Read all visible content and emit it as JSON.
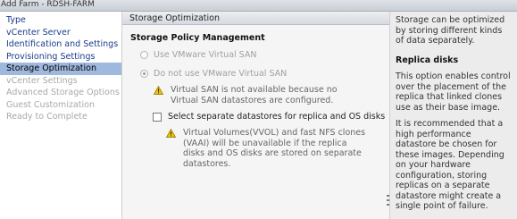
{
  "window": {
    "title": "Add Farm - RDSH-FARM"
  },
  "sidebar": {
    "items": [
      {
        "label": "Type",
        "state": "link"
      },
      {
        "label": "vCenter Server",
        "state": "link"
      },
      {
        "label": "Identification and Settings",
        "state": "link"
      },
      {
        "label": "Provisioning Settings",
        "state": "link"
      },
      {
        "label": "Storage Optimization",
        "state": "active"
      },
      {
        "label": "vCenter Settings",
        "state": "disabled"
      },
      {
        "label": "Advanced Storage Options",
        "state": "disabled"
      },
      {
        "label": "Guest Customization",
        "state": "disabled"
      },
      {
        "label": "Ready to Complete",
        "state": "disabled"
      }
    ]
  },
  "main": {
    "header": "Storage Optimization",
    "section_title": "Storage Policy Management",
    "radio_use_vsan": "Use VMware Virtual SAN",
    "radio_no_vsan": "Do not use VMware Virtual SAN",
    "vsan_warning": "Virtual SAN is not available because no\nVirtual SAN datastores are configured.",
    "separate_datastores_label": "Select separate datastores for replica and OS disks",
    "vvol_warning": "Virtual Volumes(VVOL) and fast NFS clones\n(VAAI) will be unavailable if the replica\ndisks and OS disks are stored on separate\ndatastores."
  },
  "help": {
    "intro": "Storage can be optimized by storing different kinds of data separately.",
    "title": "Replica disks",
    "paragraph1": "This option enables control over the placement of the replica that linked clones use as their base image.",
    "paragraph2": "It is recommended that a high performance datastore be chosen for these images. Depending on your hardware configuration, storing replicas on a separate datastore might create a single point of failure."
  },
  "colors": {
    "active_nav": "#9eb8de",
    "link": "#1a3c8c",
    "disabled": "#a8a8a8",
    "warning": "#f2c200"
  },
  "icons": {
    "warning": "warning-icon"
  }
}
